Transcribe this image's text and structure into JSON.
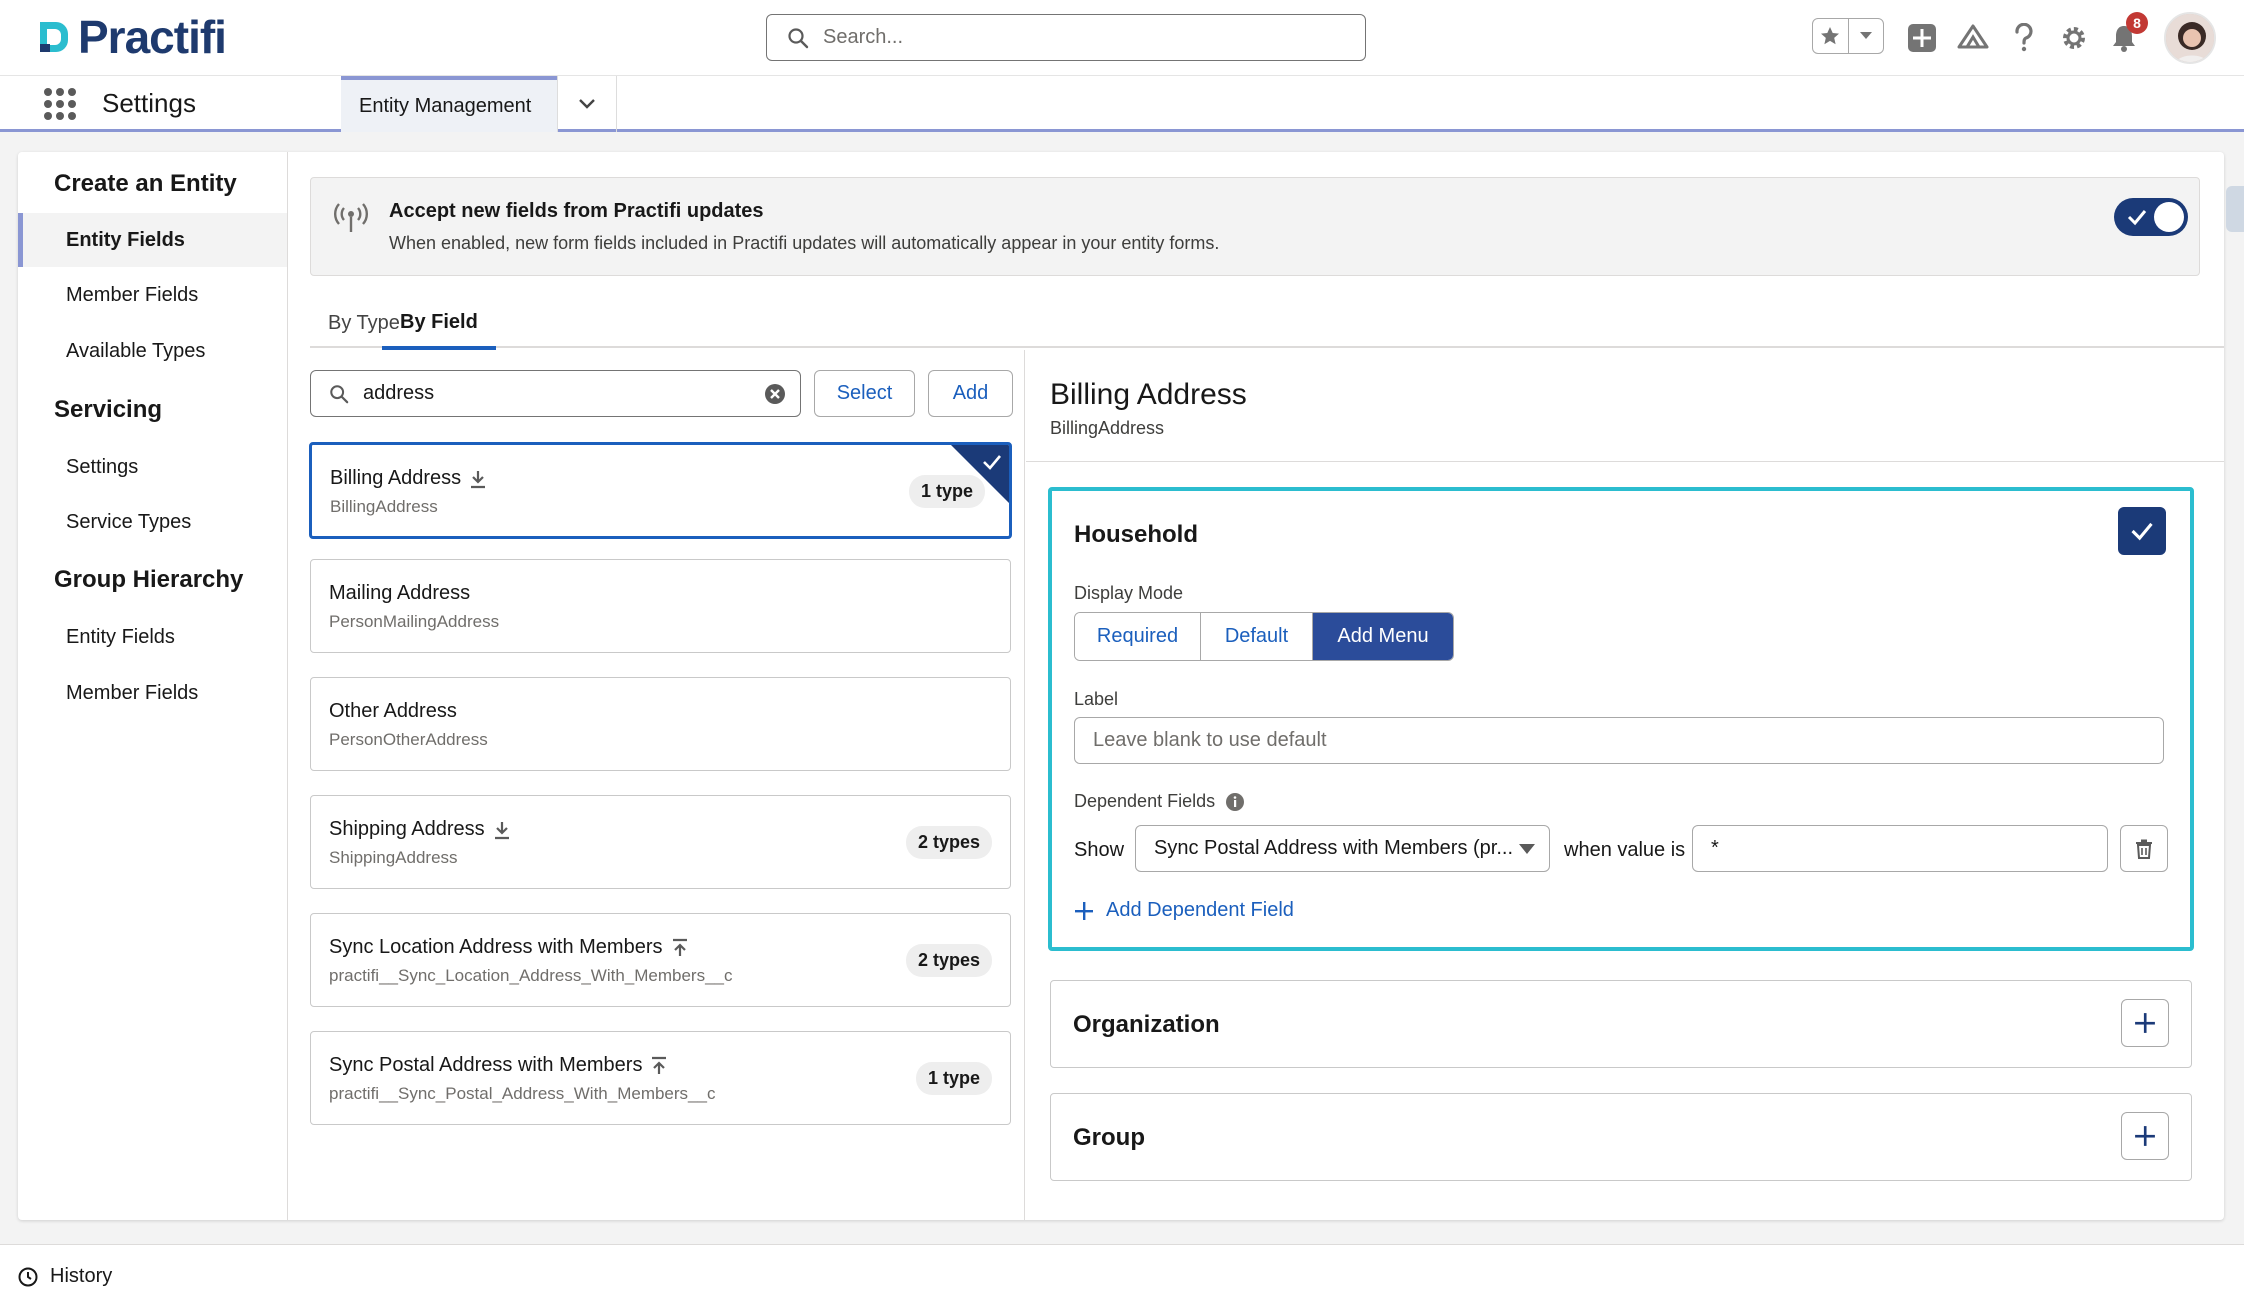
{
  "header": {
    "logo_text": "Practifi",
    "search_placeholder": "Search...",
    "notification_count": "8",
    "brand_color": "#1e3a6e"
  },
  "navbar": {
    "app_name": "Settings",
    "tab_label": "Entity Management"
  },
  "sidebar": {
    "sections": [
      {
        "heading": "Create an Entity",
        "items": [
          "Entity Fields",
          "Member Fields",
          "Available Types"
        ]
      },
      {
        "heading": "Servicing",
        "items": [
          "Settings",
          "Service Types"
        ]
      },
      {
        "heading": "Group Hierarchy",
        "items": [
          "Entity Fields",
          "Member Fields"
        ]
      }
    ],
    "active_item": "Entity Fields"
  },
  "banner": {
    "title": "Accept new fields from Practifi updates",
    "description": "When enabled, new form fields included in Practifi updates will automatically appear in your entity forms.",
    "toggle_on": true
  },
  "tabs": [
    "By Type",
    "By Field"
  ],
  "active_tab": "By Field",
  "filter": {
    "value": "address",
    "select_label": "Select",
    "add_label": "Add"
  },
  "fields": [
    {
      "name": "Billing Address",
      "api": "BillingAddress",
      "badge": "1 type",
      "icon": "download-icon",
      "selected": true
    },
    {
      "name": "Mailing Address",
      "api": "PersonMailingAddress",
      "badge": "",
      "icon": "",
      "selected": false
    },
    {
      "name": "Other Address",
      "api": "PersonOtherAddress",
      "badge": "",
      "icon": "",
      "selected": false
    },
    {
      "name": "Shipping Address",
      "api": "ShippingAddress",
      "badge": "2 types",
      "icon": "download-icon",
      "selected": false
    },
    {
      "name": "Sync Location Address with Members",
      "api": "practifi__Sync_Location_Address_With_Members__c",
      "badge": "2 types",
      "icon": "upload-icon",
      "selected": false
    },
    {
      "name": "Sync Postal Address with Members",
      "api": "practifi__Sync_Postal_Address_With_Members__c",
      "badge": "1 type",
      "icon": "upload-icon",
      "selected": false
    }
  ],
  "detail": {
    "title": "Billing Address",
    "api": "BillingAddress",
    "household": {
      "title": "Household",
      "display_mode_label": "Display Mode",
      "modes": [
        "Required",
        "Default",
        "Add Menu"
      ],
      "selected_mode": "Add Menu",
      "label_label": "Label",
      "label_placeholder": "Leave blank to use default",
      "dependent_label": "Dependent Fields",
      "show_label": "Show",
      "show_value": "Sync Postal Address with Members (pr...",
      "when_label": "when value is",
      "when_value": "*",
      "add_dependent_label": "Add Dependent Field"
    },
    "organization": {
      "title": "Organization"
    },
    "group": {
      "title": "Group"
    }
  },
  "footer": {
    "history_label": "History"
  }
}
